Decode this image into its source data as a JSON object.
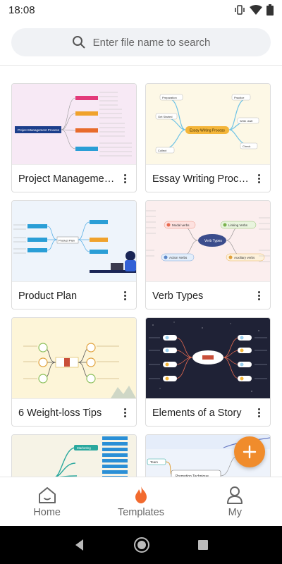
{
  "status_bar": {
    "time": "18:08"
  },
  "search": {
    "placeholder": "Enter file name to search"
  },
  "cards": [
    {
      "title": "Project Management ...",
      "thumb_bg": "#f7e9f5"
    },
    {
      "title": "Essay Writing Process",
      "thumb_bg": "#fdf8e6"
    },
    {
      "title": "Product Plan",
      "thumb_bg": "#eef4fb"
    },
    {
      "title": "Verb Types",
      "thumb_bg": "#fbeeee"
    },
    {
      "title": "6 Weight-loss Tips",
      "thumb_bg": "#fdf5d8"
    },
    {
      "title": "Elements of a Story",
      "thumb_bg": "#1f2236"
    },
    {
      "title": "",
      "thumb_bg": "#f6f3e6"
    },
    {
      "title": "",
      "thumb_bg": "#eef3fb"
    }
  ],
  "thumb_text": {
    "project": "Project Management Process",
    "essay_center": "Essay Writing Process",
    "essay_nodes": [
      "Preparation",
      "Get Started",
      "Collect",
      "Practice",
      "Write draft",
      "Check"
    ],
    "product_center": "Product Plan",
    "verb_center": "Verb Types",
    "verb_nodes": [
      "Modal verbs",
      "Linking Verbs",
      "Action Verbs",
      "Auxiliary verbs"
    ],
    "card7_nodes": [
      "Marketing"
    ],
    "card8_nodes": [
      "Team",
      "Promotion Technique"
    ]
  },
  "bottom_nav": {
    "home": "Home",
    "templates": "Templates",
    "my": "My"
  },
  "colors": {
    "accent": "#f08c2c",
    "templates_icon": "#f26a2e"
  }
}
